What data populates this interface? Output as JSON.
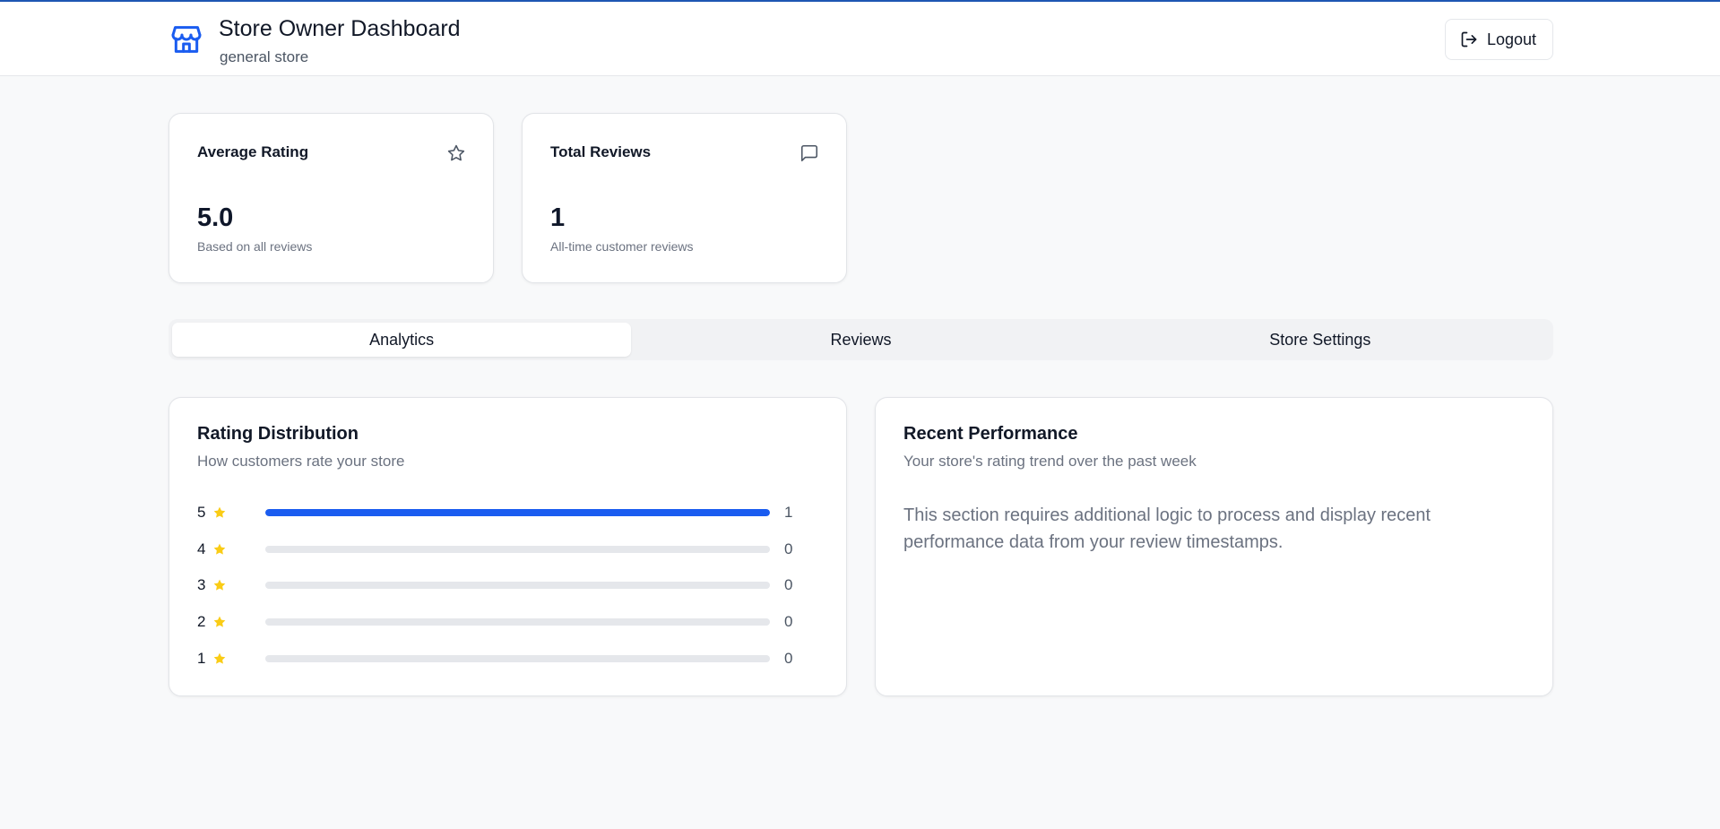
{
  "header": {
    "title": "Store Owner Dashboard",
    "subtitle": "general store",
    "logout_label": "Logout",
    "brand_icon": "store-icon"
  },
  "stats": [
    {
      "title": "Average Rating",
      "value": "5.0",
      "description": "Based on all reviews",
      "icon": "star-outline-icon"
    },
    {
      "title": "Total Reviews",
      "value": "1",
      "description": "All-time customer reviews",
      "icon": "message-square-icon"
    }
  ],
  "tabs": [
    {
      "label": "Analytics",
      "active": true
    },
    {
      "label": "Reviews",
      "active": false
    },
    {
      "label": "Store Settings",
      "active": false
    }
  ],
  "rating_distribution": {
    "title": "Rating Distribution",
    "subtitle": "How customers rate your store",
    "rows": [
      {
        "stars": "5",
        "count": "1",
        "fraction": 1.0
      },
      {
        "stars": "4",
        "count": "0",
        "fraction": 0
      },
      {
        "stars": "3",
        "count": "0",
        "fraction": 0
      },
      {
        "stars": "2",
        "count": "0",
        "fraction": 0
      },
      {
        "stars": "1",
        "count": "0",
        "fraction": 0
      }
    ]
  },
  "recent_performance": {
    "title": "Recent Performance",
    "subtitle": "Your store's rating trend over the past week",
    "body": "This section requires additional logic to process and display recent performance data from your review timestamps."
  },
  "colors": {
    "accent": "#1a5cf0",
    "star": "#facc15",
    "top_line": "#1e56b3"
  }
}
